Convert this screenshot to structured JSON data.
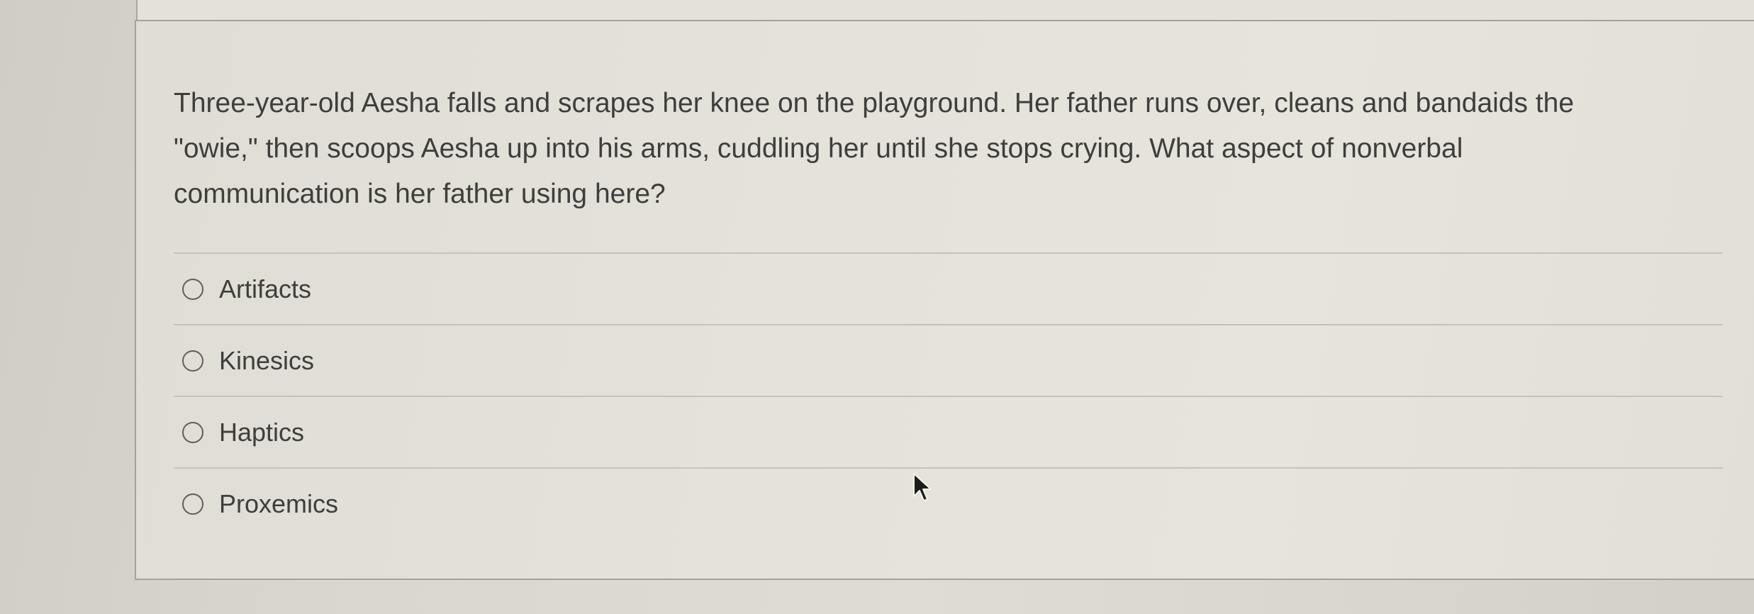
{
  "question": {
    "text": "Three-year-old Aesha falls and scrapes her knee on the playground. Her father runs over, cleans and bandaids the\n\"owie,\" then scoops Aesha up into his arms, cuddling her until she stops crying. What aspect of nonverbal\ncommunication is her father using here?"
  },
  "options": [
    {
      "label": "Artifacts",
      "selected": false
    },
    {
      "label": "Kinesics",
      "selected": false
    },
    {
      "label": "Haptics",
      "selected": false
    },
    {
      "label": "Proxemics",
      "selected": false
    }
  ],
  "cursor": {
    "icon": "mouse-pointer-icon"
  }
}
